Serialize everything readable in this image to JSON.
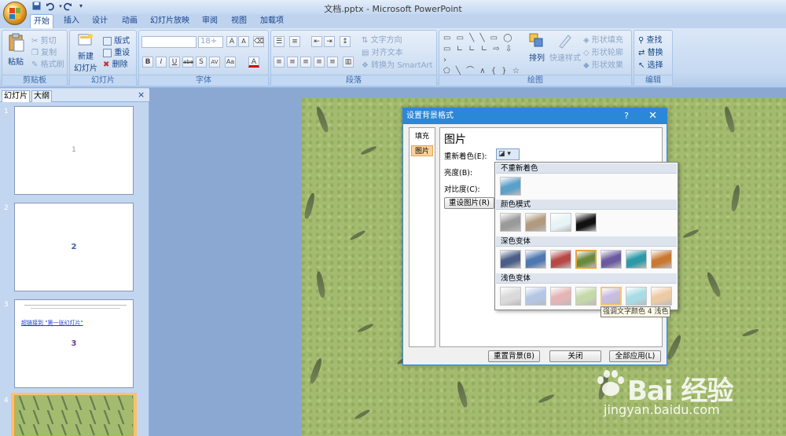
{
  "window": {
    "title": "文档.pptx - Microsoft PowerPoint"
  },
  "qat": {
    "save_icon": "save-icon",
    "undo_icon": "undo-icon",
    "redo_icon": "redo-icon",
    "more_icon": "customize-icon"
  },
  "tabs": [
    "开始",
    "插入",
    "设计",
    "动画",
    "幻灯片放映",
    "审阅",
    "视图",
    "加载项"
  ],
  "ribbon": {
    "clipboard": {
      "label": "剪贴板",
      "paste": "粘贴",
      "cut": "剪切",
      "copy": "复制",
      "format_painter": "格式刷"
    },
    "slides": {
      "label": "幻灯片",
      "new_slide": "新建",
      "new_slide2": "幻灯片",
      "layout": "版式",
      "reset": "重设",
      "delete": "删除"
    },
    "font": {
      "label": "字体",
      "size": "18+",
      "grow": "A",
      "shrink": "A",
      "bold": "B",
      "italic": "I",
      "underline": "U",
      "strike": "abe",
      "shadow": "S",
      "spacing": "AV",
      "case": "Aa",
      "color": "A"
    },
    "paragraph": {
      "label": "段落",
      "text_direction": "文字方向",
      "align_text": "对齐文本",
      "smartart": "转换为 SmartArt"
    },
    "drawing": {
      "label": "绘图",
      "arrange": "排列",
      "quick_styles": "快速样式",
      "fill": "形状填充",
      "outline": "形状轮廓",
      "effects": "形状效果"
    },
    "editing": {
      "label": "编辑",
      "find": "查找",
      "replace": "替换",
      "select": "选择"
    }
  },
  "pane": {
    "tab_slides": "幻灯片",
    "tab_outline": "大纲",
    "close": "×"
  },
  "thumbnails": [
    {
      "num": "1",
      "text": "1"
    },
    {
      "num": "2",
      "text": "2"
    },
    {
      "num": "3",
      "text": "3",
      "link": "超链接到 \"第一张幻灯片\""
    },
    {
      "num": "4",
      "text": ""
    }
  ],
  "dialog": {
    "title": "设置背景格式",
    "help": "?",
    "close": "✕",
    "nav": [
      "填充",
      "图片"
    ],
    "heading": "图片",
    "recolor_label": "重新着色(E):",
    "brightness_label": "亮度(B):",
    "contrast_label": "对比度(C):",
    "reset_picture": "重设图片(R)",
    "reset_background": "重置背景(B)",
    "close_button": "关闭",
    "apply_all": "全部应用(L)"
  },
  "dropdown": {
    "no_recolor": "不重新着色",
    "color_modes": "颜色模式",
    "dark_variations": "深色变体",
    "light_variations": "浅色变体",
    "no_recolor_swatch": "#5aa0c8",
    "mode_swatches": [
      "#9a9a9a",
      "#b09a80",
      "#e6f4f6",
      "#111111"
    ],
    "dark_swatches": [
      "#4a5e88",
      "#4e78b0",
      "#b84848",
      "#6a8a3e",
      "#6c5aa0",
      "#2c98a8",
      "#c87830"
    ],
    "light_swatches": [
      "#dadada",
      "#b4c6e4",
      "#e6b4b4",
      "#c4d8a8",
      "#c8bce0",
      "#a8dce4",
      "#eccaa4"
    ]
  },
  "tooltip": "强调文字颜色 4 浅色",
  "watermark": {
    "brand": "Bai 经验",
    "url": "jingyan.baidu.com"
  }
}
